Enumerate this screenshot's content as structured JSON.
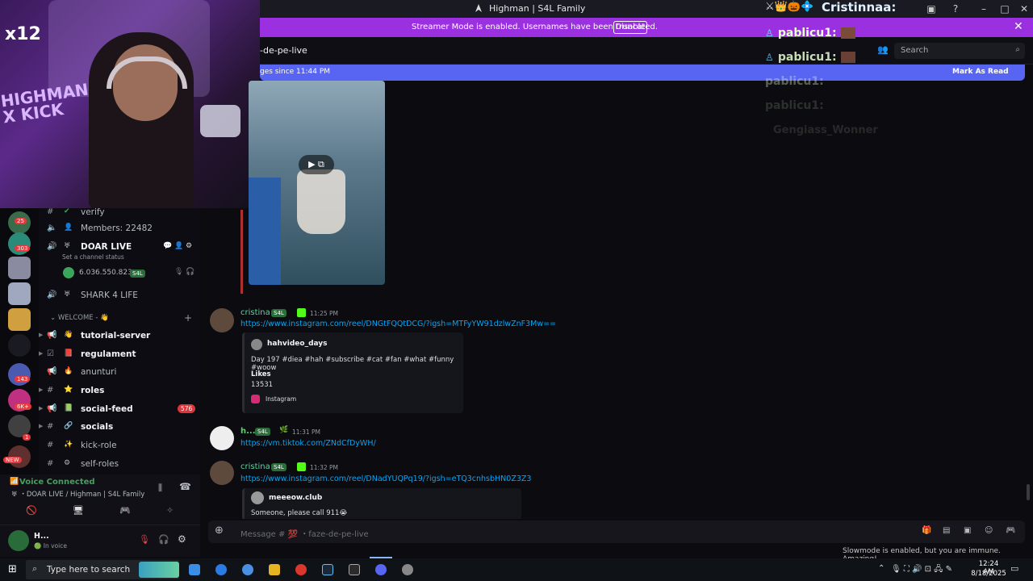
{
  "window": {
    "title": "Highman | S4L Family"
  },
  "banner": {
    "text": "Streamer Mode is enabled. Usernames have been truncated.",
    "button": "Disable"
  },
  "overlay": {
    "name": "Cristinnaa:",
    "viewers": [
      "pablicu1:",
      "pablicu1:",
      "pablicu1:",
      "pablicu1:"
    ],
    "faded": "Gengiass_Wonner"
  },
  "webcam": {
    "multiplier": "x12",
    "sign": "HIGHMAN X KICK"
  },
  "header": {
    "channel": "-de-pe-live",
    "search_placeholder": "Search"
  },
  "newbar": {
    "left": "ges since 11:44 PM",
    "right": "Mark As Read"
  },
  "channels": {
    "verify": "verify",
    "members": "Members: 22482",
    "doar_live": "DOAR LIVE",
    "doar_status": "Set a channel status",
    "voice_user": "6.036.550.823",
    "voice_user_tag": "S4L",
    "shark": "SHARK 4 LIFE",
    "category": "WELCOME -",
    "items": [
      {
        "label": "tutorial-server",
        "emoji": "👋"
      },
      {
        "label": "regulament",
        "emoji": "📕"
      },
      {
        "label": "anunturi",
        "emoji": "🔥"
      },
      {
        "label": "roles",
        "emoji": "⭐"
      },
      {
        "label": "social-feed",
        "emoji": "📗",
        "badge": "576"
      },
      {
        "label": "socials",
        "emoji": "🔗"
      },
      {
        "label": "kick-role",
        "emoji": "✨"
      },
      {
        "label": "self-roles",
        "emoji": "⚙"
      }
    ]
  },
  "rail_badges": [
    "25",
    "303",
    "143",
    "6K+",
    "1",
    "NEW"
  ],
  "voice": {
    "status": "Voice Connected",
    "channel": "DOAR LIVE / Highman | S4L Family"
  },
  "user": {
    "name": "H...",
    "status": "In voice"
  },
  "messages": [
    {
      "user": "cristina",
      "tag": "S4L",
      "time": "11:25 PM",
      "link": "https://www.instagram.com/reel/DNGtFQQtDCG/?igsh=MTFyYW91dzlwZnF3Mw==",
      "embed": {
        "author": "hahvideo_days",
        "desc": "Day 197 #diea #hah #subscribe #cat #fan #what #funny #woow",
        "likes_label": "Likes",
        "likes": "13531",
        "footer": "Instagram"
      }
    },
    {
      "user": "h...",
      "tag": "S4L",
      "time": "11:31 PM",
      "link": "https://vm.tiktok.com/ZNdCfDyWH/"
    },
    {
      "user": "cristina",
      "tag": "S4L",
      "time": "11:32 PM",
      "link": "https://www.instagram.com/reel/DNadYUQPq19/?igsh=eTQ3cnhsbHN0Z3Z3",
      "embed": {
        "author": "meeeow.club",
        "desc": "Someone, please call 911😭"
      }
    }
  ],
  "composer": {
    "placeholder": "Message # 💯 ・faze-de-pe-live"
  },
  "slowmode": "Slowmode is enabled, but you are immune. Amazing!",
  "taskbar": {
    "search": "Type here to search",
    "time": "12:24 AM",
    "date": "8/18/2025"
  }
}
